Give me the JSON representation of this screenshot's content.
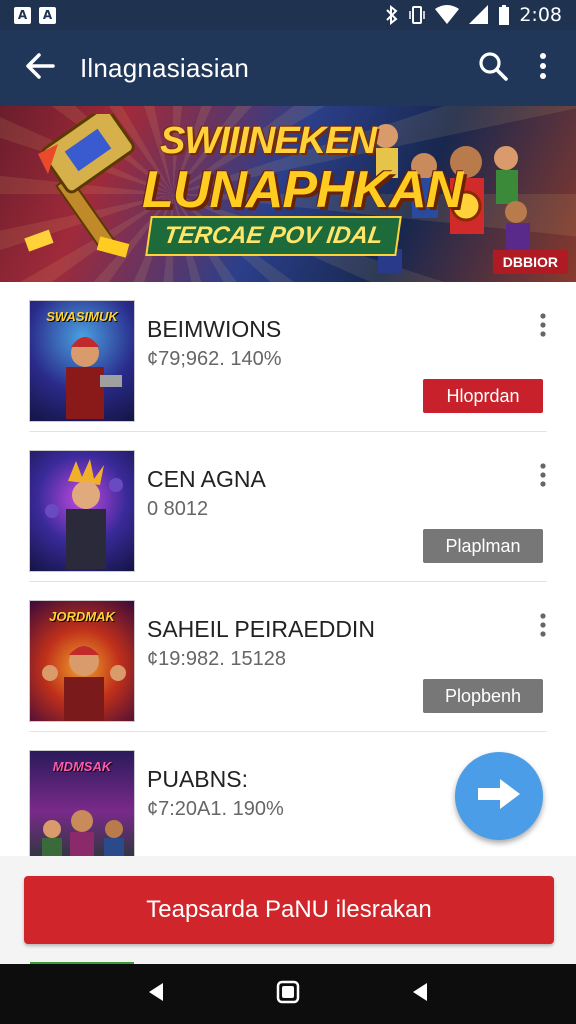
{
  "status_bar": {
    "notif_icons": [
      "A",
      "A"
    ],
    "time": "2:08",
    "icons": [
      "bluetooth-icon",
      "vibrate-icon",
      "wifi-icon",
      "signal-icon",
      "battery-icon"
    ]
  },
  "app_bar": {
    "title": "Ilnagnasiasian",
    "back_icon": "back-arrow-icon",
    "search_icon": "search-icon",
    "menu_icon": "more-vert-icon"
  },
  "banner": {
    "line1": "SWIIINEKEN",
    "line2": "LUNAPHKAN",
    "line3": "TERCAE POV IDAL",
    "badge": "DBBIOR"
  },
  "list": [
    {
      "title": "BEIMWIONS",
      "subtitle": "¢79;962. 140%",
      "button": "Hloprdan",
      "button_style": "red",
      "thumb_title": "SWASIMUK"
    },
    {
      "title": "CEN AGNA",
      "subtitle": "0 8012",
      "button": "Plaplman",
      "button_style": "gray",
      "thumb_title": ""
    },
    {
      "title": "SAHEIL PEIRAEDDIN",
      "subtitle": "¢19:982. 15128",
      "button": "Plopbenh",
      "button_style": "gray",
      "thumb_title": "JORDMAK"
    },
    {
      "title": "PUABNS:",
      "subtitle": "¢7:20A1. 190%",
      "button": "",
      "button_style": "",
      "thumb_title": "MDMSAK"
    }
  ],
  "fab": {
    "icon": "arrow-right-icon"
  },
  "primary_button": {
    "label": "Teapsarda PaNU ilesrakan"
  },
  "nav_bar": {
    "icons": [
      "back-triangle-icon",
      "home-square-icon",
      "recents-icon"
    ]
  },
  "colors": {
    "app_bar": "#21375a",
    "status_bar": "#1f3250",
    "accent_red": "#c8212b",
    "fab_blue": "#4a9de6",
    "gray_button": "#777777"
  }
}
